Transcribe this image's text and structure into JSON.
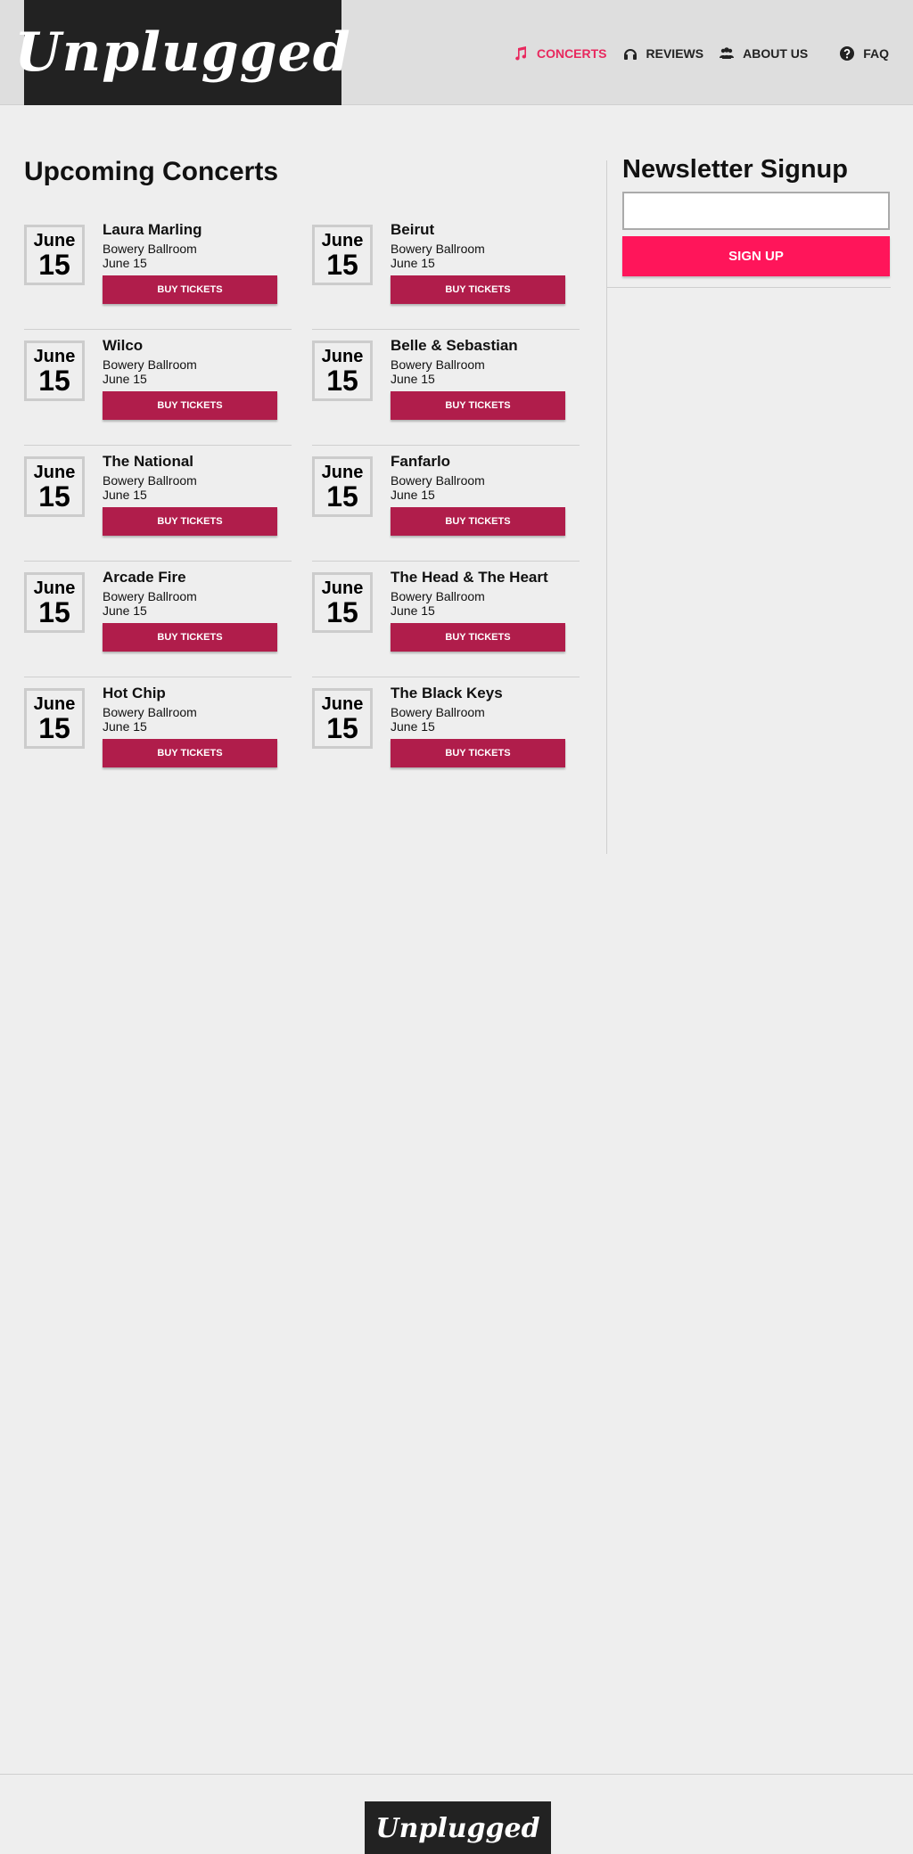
{
  "brand": {
    "name": "Unplugged"
  },
  "colors": {
    "accent": "#e8285e",
    "buy_button": "#b01d4b",
    "signup_button": "#ff155a",
    "logo_bg": "#222222"
  },
  "nav": {
    "items": [
      {
        "label": "Concerts",
        "icon": "music-note-icon",
        "active": true
      },
      {
        "label": "Reviews",
        "icon": "headphones-icon",
        "active": false
      },
      {
        "label": "About Us",
        "icon": "users-icon",
        "active": false
      },
      {
        "label": "FAQ",
        "icon": "question-circle-icon",
        "active": false
      }
    ]
  },
  "main": {
    "title": "Upcoming Concerts",
    "buy_label": "Buy Tickets",
    "concerts_left": [
      {
        "month": "June",
        "day": "15",
        "band": "Laura Marling",
        "venue": "Bowery Ballroom",
        "date": "June 15"
      },
      {
        "month": "June",
        "day": "15",
        "band": "Wilco",
        "venue": "Bowery Ballroom",
        "date": "June 15"
      },
      {
        "month": "June",
        "day": "15",
        "band": "The National",
        "venue": "Bowery Ballroom",
        "date": "June 15"
      },
      {
        "month": "June",
        "day": "15",
        "band": "Arcade Fire",
        "venue": "Bowery Ballroom",
        "date": "June 15"
      },
      {
        "month": "June",
        "day": "15",
        "band": "Hot Chip",
        "venue": "Bowery Ballroom",
        "date": "June 15"
      }
    ],
    "concerts_right": [
      {
        "month": "June",
        "day": "15",
        "band": "Beirut",
        "venue": "Bowery Ballroom",
        "date": "June 15"
      },
      {
        "month": "June",
        "day": "15",
        "band": "Belle & Sebastian",
        "venue": "Bowery Ballroom",
        "date": "June 15"
      },
      {
        "month": "June",
        "day": "15",
        "band": "Fanfarlo",
        "venue": "Bowery Ballroom",
        "date": "June 15"
      },
      {
        "month": "June",
        "day": "15",
        "band": "The Head & The Heart",
        "venue": "Bowery Ballroom",
        "date": "June 15"
      },
      {
        "month": "June",
        "day": "15",
        "band": "The Black Keys",
        "venue": "Bowery Ballroom",
        "date": "June 15"
      }
    ]
  },
  "sidebar": {
    "title": "Newsletter Signup",
    "email_value": "",
    "email_placeholder": "",
    "signup_label": "Sign Up"
  },
  "footer": {
    "logo": "Unplugged"
  }
}
